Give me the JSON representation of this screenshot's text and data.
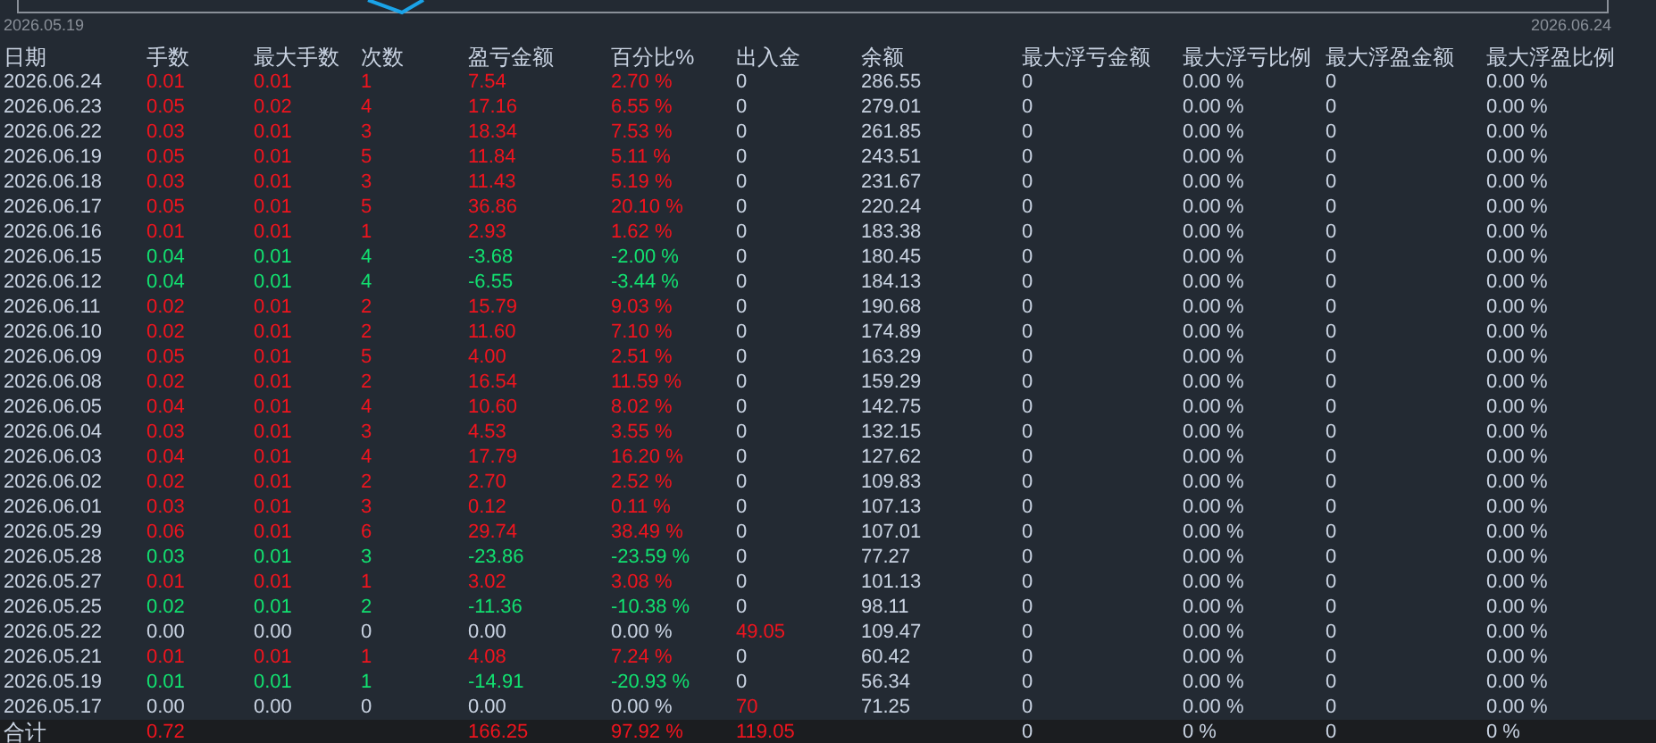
{
  "chart": {
    "start_label": "2026.05.19",
    "end_label": "2026.06.24"
  },
  "table": {
    "columns": [
      "日期",
      "手数",
      "最大手数",
      "次数",
      "盈亏金额",
      "百分比%",
      "出入金",
      "余额",
      "最大浮亏金额",
      "最大浮亏比例",
      "最大浮盈金额",
      "最大浮盈比例"
    ],
    "rows": [
      {
        "kind": "profit",
        "deposit_highlighted": false,
        "cells": [
          "2026.06.24",
          "0.01",
          "0.01",
          "1",
          "7.54",
          "2.70 %",
          "0",
          "286.55",
          "0",
          "0.00 %",
          "0",
          "0.00 %"
        ]
      },
      {
        "kind": "profit",
        "deposit_highlighted": false,
        "cells": [
          "2026.06.23",
          "0.05",
          "0.02",
          "4",
          "17.16",
          "6.55 %",
          "0",
          "279.01",
          "0",
          "0.00 %",
          "0",
          "0.00 %"
        ]
      },
      {
        "kind": "profit",
        "deposit_highlighted": false,
        "cells": [
          "2026.06.22",
          "0.03",
          "0.01",
          "3",
          "18.34",
          "7.53 %",
          "0",
          "261.85",
          "0",
          "0.00 %",
          "0",
          "0.00 %"
        ]
      },
      {
        "kind": "profit",
        "deposit_highlighted": false,
        "cells": [
          "2026.06.19",
          "0.05",
          "0.01",
          "5",
          "11.84",
          "5.11 %",
          "0",
          "243.51",
          "0",
          "0.00 %",
          "0",
          "0.00 %"
        ]
      },
      {
        "kind": "profit",
        "deposit_highlighted": false,
        "cells": [
          "2026.06.18",
          "0.03",
          "0.01",
          "3",
          "11.43",
          "5.19 %",
          "0",
          "231.67",
          "0",
          "0.00 %",
          "0",
          "0.00 %"
        ]
      },
      {
        "kind": "profit",
        "deposit_highlighted": false,
        "cells": [
          "2026.06.17",
          "0.05",
          "0.01",
          "5",
          "36.86",
          "20.10 %",
          "0",
          "220.24",
          "0",
          "0.00 %",
          "0",
          "0.00 %"
        ]
      },
      {
        "kind": "profit",
        "deposit_highlighted": false,
        "cells": [
          "2026.06.16",
          "0.01",
          "0.01",
          "1",
          "2.93",
          "1.62 %",
          "0",
          "183.38",
          "0",
          "0.00 %",
          "0",
          "0.00 %"
        ]
      },
      {
        "kind": "loss",
        "deposit_highlighted": false,
        "cells": [
          "2026.06.15",
          "0.04",
          "0.01",
          "4",
          "-3.68",
          "-2.00 %",
          "0",
          "180.45",
          "0",
          "0.00 %",
          "0",
          "0.00 %"
        ]
      },
      {
        "kind": "loss",
        "deposit_highlighted": false,
        "cells": [
          "2026.06.12",
          "0.04",
          "0.01",
          "4",
          "-6.55",
          "-3.44 %",
          "0",
          "184.13",
          "0",
          "0.00 %",
          "0",
          "0.00 %"
        ]
      },
      {
        "kind": "profit",
        "deposit_highlighted": false,
        "cells": [
          "2026.06.11",
          "0.02",
          "0.01",
          "2",
          "15.79",
          "9.03 %",
          "0",
          "190.68",
          "0",
          "0.00 %",
          "0",
          "0.00 %"
        ]
      },
      {
        "kind": "profit",
        "deposit_highlighted": false,
        "cells": [
          "2026.06.10",
          "0.02",
          "0.01",
          "2",
          "11.60",
          "7.10 %",
          "0",
          "174.89",
          "0",
          "0.00 %",
          "0",
          "0.00 %"
        ]
      },
      {
        "kind": "profit",
        "deposit_highlighted": false,
        "cells": [
          "2026.06.09",
          "0.05",
          "0.01",
          "5",
          "4.00",
          "2.51 %",
          "0",
          "163.29",
          "0",
          "0.00 %",
          "0",
          "0.00 %"
        ]
      },
      {
        "kind": "profit",
        "deposit_highlighted": false,
        "cells": [
          "2026.06.08",
          "0.02",
          "0.01",
          "2",
          "16.54",
          "11.59 %",
          "0",
          "159.29",
          "0",
          "0.00 %",
          "0",
          "0.00 %"
        ]
      },
      {
        "kind": "profit",
        "deposit_highlighted": false,
        "cells": [
          "2026.06.05",
          "0.04",
          "0.01",
          "4",
          "10.60",
          "8.02 %",
          "0",
          "142.75",
          "0",
          "0.00 %",
          "0",
          "0.00 %"
        ]
      },
      {
        "kind": "profit",
        "deposit_highlighted": false,
        "cells": [
          "2026.06.04",
          "0.03",
          "0.01",
          "3",
          "4.53",
          "3.55 %",
          "0",
          "132.15",
          "0",
          "0.00 %",
          "0",
          "0.00 %"
        ]
      },
      {
        "kind": "profit",
        "deposit_highlighted": false,
        "cells": [
          "2026.06.03",
          "0.04",
          "0.01",
          "4",
          "17.79",
          "16.20 %",
          "0",
          "127.62",
          "0",
          "0.00 %",
          "0",
          "0.00 %"
        ]
      },
      {
        "kind": "profit",
        "deposit_highlighted": false,
        "cells": [
          "2026.06.02",
          "0.02",
          "0.01",
          "2",
          "2.70",
          "2.52 %",
          "0",
          "109.83",
          "0",
          "0.00 %",
          "0",
          "0.00 %"
        ]
      },
      {
        "kind": "profit",
        "deposit_highlighted": false,
        "cells": [
          "2026.06.01",
          "0.03",
          "0.01",
          "3",
          "0.12",
          "0.11 %",
          "0",
          "107.13",
          "0",
          "0.00 %",
          "0",
          "0.00 %"
        ]
      },
      {
        "kind": "profit",
        "deposit_highlighted": false,
        "cells": [
          "2026.05.29",
          "0.06",
          "0.01",
          "6",
          "29.74",
          "38.49 %",
          "0",
          "107.01",
          "0",
          "0.00 %",
          "0",
          "0.00 %"
        ]
      },
      {
        "kind": "loss",
        "deposit_highlighted": false,
        "cells": [
          "2026.05.28",
          "0.03",
          "0.01",
          "3",
          "-23.86",
          "-23.59 %",
          "0",
          "77.27",
          "0",
          "0.00 %",
          "0",
          "0.00 %"
        ]
      },
      {
        "kind": "profit",
        "deposit_highlighted": false,
        "cells": [
          "2026.05.27",
          "0.01",
          "0.01",
          "1",
          "3.02",
          "3.08 %",
          "0",
          "101.13",
          "0",
          "0.00 %",
          "0",
          "0.00 %"
        ]
      },
      {
        "kind": "loss",
        "deposit_highlighted": false,
        "cells": [
          "2026.05.25",
          "0.02",
          "0.01",
          "2",
          "-11.36",
          "-10.38 %",
          "0",
          "98.11",
          "0",
          "0.00 %",
          "0",
          "0.00 %"
        ]
      },
      {
        "kind": "flat",
        "deposit_highlighted": true,
        "cells": [
          "2026.05.22",
          "0.00",
          "0.00",
          "0",
          "0.00",
          "0.00 %",
          "49.05",
          "109.47",
          "0",
          "0.00 %",
          "0",
          "0.00 %"
        ]
      },
      {
        "kind": "profit",
        "deposit_highlighted": false,
        "cells": [
          "2026.05.21",
          "0.01",
          "0.01",
          "1",
          "4.08",
          "7.24 %",
          "0",
          "60.42",
          "0",
          "0.00 %",
          "0",
          "0.00 %"
        ]
      },
      {
        "kind": "loss",
        "deposit_highlighted": false,
        "cells": [
          "2026.05.19",
          "0.01",
          "0.01",
          "1",
          "-14.91",
          "-20.93 %",
          "0",
          "56.34",
          "0",
          "0.00 %",
          "0",
          "0.00 %"
        ]
      },
      {
        "kind": "flat",
        "deposit_highlighted": true,
        "cells": [
          "2026.05.17",
          "0.00",
          "0.00",
          "0",
          "0.00",
          "0.00 %",
          "70",
          "71.25",
          "0",
          "0.00 %",
          "0",
          "0.00 %"
        ]
      }
    ],
    "total": {
      "kind": "profit",
      "deposit_highlighted": true,
      "cells": [
        "合计",
        "0.72",
        null,
        null,
        "166.25",
        "97.92 %",
        "119.05",
        null,
        "0",
        "0 %",
        "0",
        "0 %"
      ]
    }
  }
}
